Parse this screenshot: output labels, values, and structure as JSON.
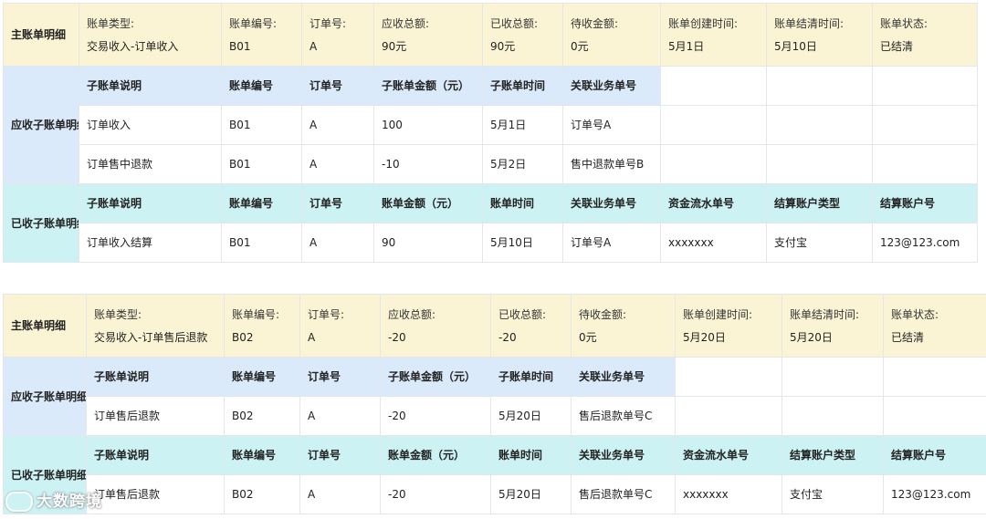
{
  "bills": [
    {
      "main": {
        "section": "主账单明细",
        "fields": [
          {
            "label": "账单类型:",
            "value": "交易收入-订单收入"
          },
          {
            "label": "账单编号:",
            "value": "B01"
          },
          {
            "label": "订单号:",
            "value": "A"
          },
          {
            "label": "应收总额:",
            "value": "90元"
          },
          {
            "label": "已收总额:",
            "value": "90元"
          },
          {
            "label": "待收金额:",
            "value": "0元"
          },
          {
            "label": "账单创建时间:",
            "value": "5月1日"
          },
          {
            "label": "账单结清时间:",
            "value": "5月10日"
          },
          {
            "label": "账单状态:",
            "value": "已结清"
          }
        ]
      },
      "receivable": {
        "section": "应收子账单明细",
        "headers": [
          "子账单说明",
          "账单编号",
          "订单号",
          "子账单金额（元）",
          "子账单时间",
          "关联业务单号"
        ],
        "rows": [
          [
            "订单收入",
            "B01",
            "A",
            "100",
            "5月1日",
            "订单号A"
          ],
          [
            "订单售中退款",
            "B01",
            "A",
            "-10",
            "5月2日",
            "售中退款单号B"
          ]
        ]
      },
      "received": {
        "section": "已收子账单明细",
        "headers": [
          "子账单说明",
          "账单编号",
          "订单号",
          "账单金额（元）",
          "账单时间",
          "关联业务单号",
          "资金流水单号",
          "结算账户类型",
          "结算账户号"
        ],
        "rows": [
          [
            "订单收入结算",
            "B01",
            "A",
            "90",
            "5月10日",
            "订单号A",
            "xxxxxxx",
            "支付宝",
            "123@123.com"
          ]
        ]
      }
    },
    {
      "main": {
        "section": "主账单明细",
        "fields": [
          {
            "label": "账单类型:",
            "value": "交易收入-订单售后退款"
          },
          {
            "label": "账单编号:",
            "value": "B02"
          },
          {
            "label": "订单号:",
            "value": "A"
          },
          {
            "label": "应收总额:",
            "value": "-20"
          },
          {
            "label": "已收总额:",
            "value": "-20"
          },
          {
            "label": "待收金额:",
            "value": "0元"
          },
          {
            "label": "账单创建时间:",
            "value": "5月20日"
          },
          {
            "label": "账单结清时间:",
            "value": "5月20日"
          },
          {
            "label": "账单状态:",
            "value": "已结清"
          }
        ]
      },
      "receivable": {
        "section": "应收子账单明细",
        "headers": [
          "子账单说明",
          "账单编号",
          "订单号",
          "子账单金额（元）",
          "子账单时间",
          "关联业务单号"
        ],
        "rows": [
          [
            "订单售后退款",
            "B02",
            "A",
            "-20",
            "5月20日",
            "售后退款单号C"
          ]
        ]
      },
      "received": {
        "section": "已收子账单明细",
        "headers": [
          "子账单说明",
          "账单编号",
          "订单号",
          "账单金额（元）",
          "账单时间",
          "关联业务单号",
          "资金流水单号",
          "结算账户类型",
          "结算账户号"
        ],
        "rows": [
          [
            "订单售后退款",
            "B02",
            "A",
            "-20",
            "5月20日",
            "售后退款单号C",
            "xxxxxxx",
            "支付宝",
            "123@123.com"
          ]
        ]
      }
    }
  ],
  "watermark": "大数跨境"
}
